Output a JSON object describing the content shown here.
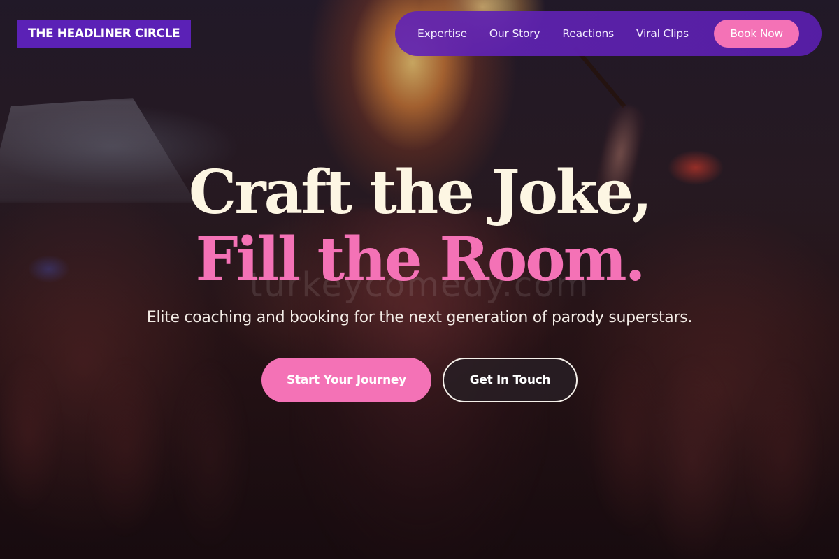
{
  "brand": {
    "name": "THE HEADLINER CIRCLE"
  },
  "nav": {
    "items": [
      {
        "label": "Expertise"
      },
      {
        "label": "Our Story"
      },
      {
        "label": "Reactions"
      },
      {
        "label": "Viral Clips"
      }
    ],
    "cta_label": "Book Now"
  },
  "hero": {
    "title_line_1": "Craft the Joke,",
    "title_line_2": "Fill the Room.",
    "subtitle": "Elite coaching and booking for the next generation of parody superstars.",
    "primary_cta": "Start Your Journey",
    "secondary_cta": "Get In Touch",
    "watermark": "turkeycomedy.com"
  },
  "colors": {
    "brand_purple": "#5b21b6",
    "nav_purple": "#5e22b0",
    "accent_pink": "#f472b6",
    "title_cream": "#fdf6e3"
  }
}
